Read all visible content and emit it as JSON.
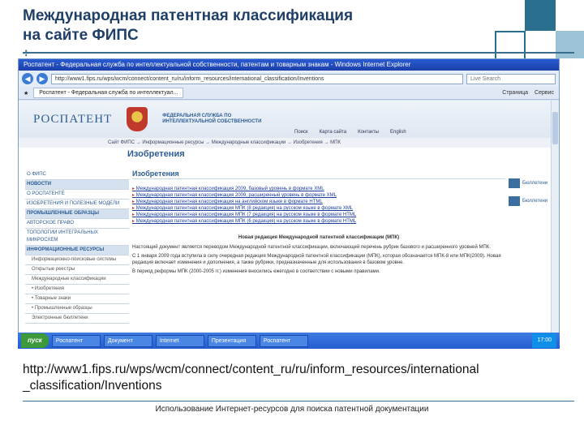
{
  "slide": {
    "title_line1": "Международная патентная классификация",
    "title_line2": "на сайте ФИПС",
    "url_line1": "http://www1.fips.ru/wps/wcm/connect/content_ru/ru/inform_resources/international",
    "url_line2": "_classification/Inventions",
    "footer": "Использование Интернет-ресурсов для поиска патентной документации"
  },
  "browser": {
    "title": "Роспатент - Федеральная служба по интеллектуальной собственности, патентам и товарным знакам - Windows Internet Explorer",
    "address": "http://www1.fips.ru/wps/wcm/connect/content_ru/ru/inform_resources/international_classification/Inventions",
    "search_placeholder": "Live Search",
    "tab_label": "Роспатент - Федеральная служба по интеллектуал...",
    "tools": [
      "Страница",
      "Сервис"
    ]
  },
  "site": {
    "logo": "РОСПАТЕНТ",
    "agency": "ФЕДЕРАЛЬНАЯ СЛУЖБА ПО ИНТЕЛЛЕКТУАЛЬНОЙ СОБСТВЕННОСТИ",
    "top_links": [
      "Поиск",
      "Карта сайта",
      "Контакты",
      "English"
    ],
    "breadcrumb": "Сайт ФИПС → Информационные ресурсы → Международные классификации → Изобретения → МПК",
    "section_title": "Изобретения",
    "left_menu": [
      {
        "label": "О ФИПС",
        "type": "item"
      },
      {
        "label": "НОВОСТИ",
        "type": "head"
      },
      {
        "label": "О РОСПАТЕНТЕ",
        "type": "item"
      },
      {
        "label": "ИЗОБРЕТЕНИЯ И ПОЛЕЗНЫЕ МОДЕЛИ",
        "type": "item"
      },
      {
        "label": "ПРОМЫШЛЕННЫЕ ОБРАЗЦЫ",
        "type": "head"
      },
      {
        "label": "АВТОРСКОЕ ПРАВО",
        "type": "item"
      },
      {
        "label": "ТОПОЛОГИИ ИНТЕГРАЛЬНЫХ МИКРОСХЕМ",
        "type": "item"
      },
      {
        "label": "ИНФОРМАЦИОННЫЕ РЕСУРСЫ",
        "type": "head"
      },
      {
        "label": "Информационно-поисковые системы",
        "type": "sub"
      },
      {
        "label": "Открытые реестры",
        "type": "sub"
      },
      {
        "label": "Международные классификации",
        "type": "sub"
      },
      {
        "label": "• Изобретения",
        "type": "sub"
      },
      {
        "label": "• Товарные знаки",
        "type": "sub"
      },
      {
        "label": "• Промышленные образцы",
        "type": "sub"
      },
      {
        "label": "Электронные бюллетени",
        "type": "sub"
      }
    ],
    "content_heading": "Изобретения",
    "links": [
      "Международная патентная классификация 2009, базовый уровень в формате XML",
      "Международная патентная классификация 2009, расширенный уровень в формате XML",
      "Международная патентная классификация на английском языке в формате HTML",
      "Международная патентная классификация МПК (8 редакция) на русском языке в формате XML",
      "Международная патентная классификация МПК (7 редакция) на русском языке в формате HTML",
      "Международная патентная классификация МПК (6 редакция) на русском языке в формате HTML"
    ],
    "para_title": "Новая редакция Международной патентной классификации (МПК)",
    "paragraphs": [
      "Настоящий документ является переводом Международной патентной классификации, включающей перечень рубрик базового и расширенного уровней МПК.",
      "С 1 января 2009 года вступила в силу очередная редакция Международной патентной классификации (МПК), которая обозначается МПК-8 или МПК(2009). Новая редакция включает изменения и дополнения, а также рубрики, предназначенные для использования в базовом уровне.",
      "В период реформы МПК (2000-2005 гг.) изменения вносились ежегодно в соответствии с новыми правилами."
    ],
    "right_icons": [
      "Бюллетени",
      "Бюллетени"
    ]
  },
  "taskbar": {
    "start_label": "пуск",
    "tasks": [
      "Роспатент",
      "Документ",
      "Internet",
      "Презентация",
      "Роспатент"
    ],
    "clock": "17:00"
  }
}
